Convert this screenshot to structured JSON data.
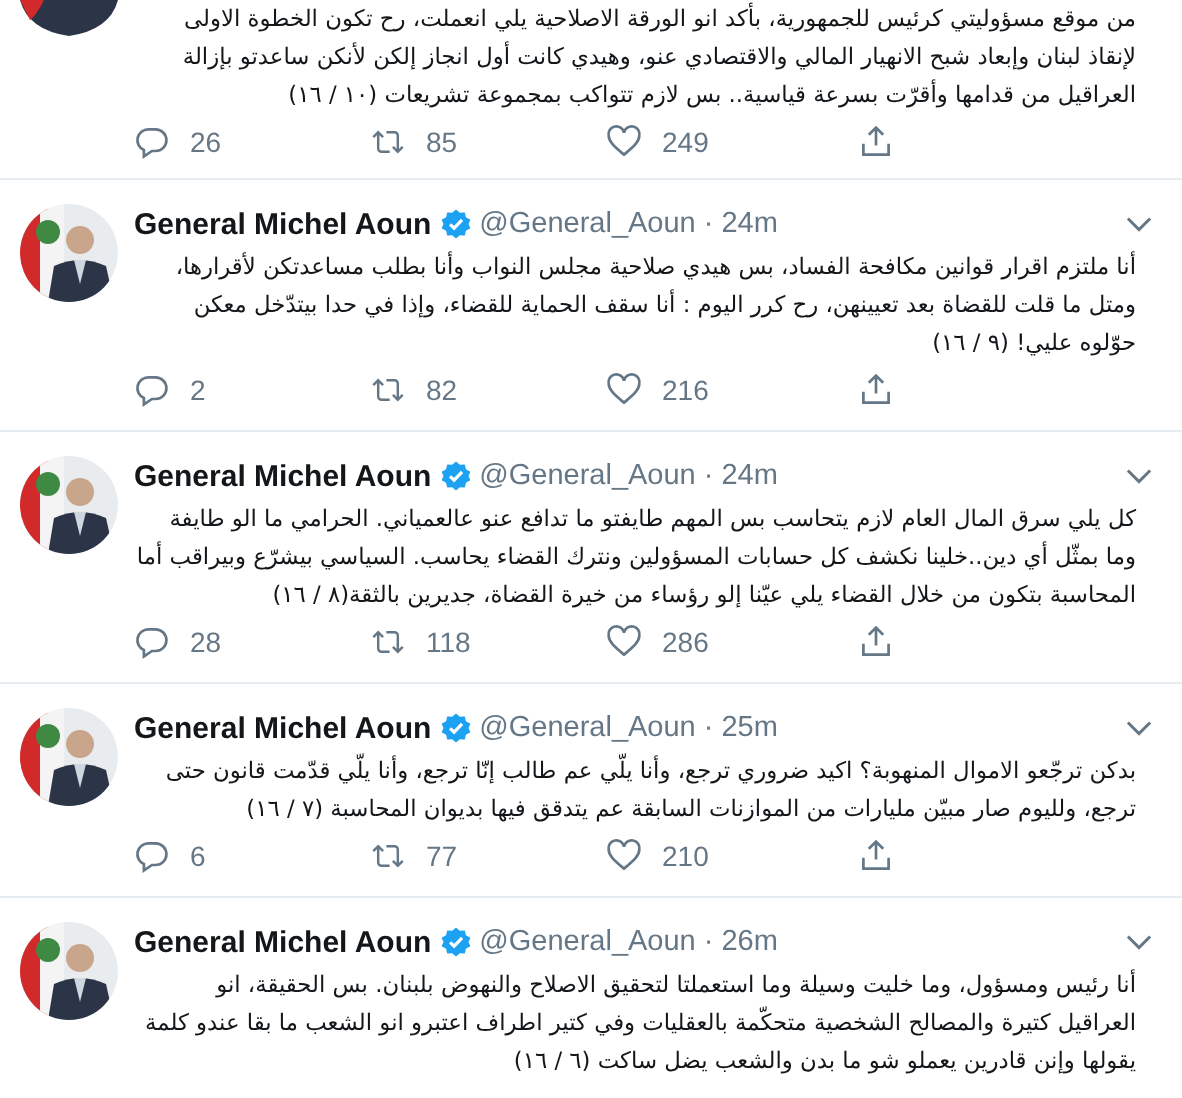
{
  "tweets": [
    {
      "header": false,
      "text": "من موقع مسؤوليتي كرئيس للجمهورية، بأكد انو الورقة الاصلاحية يلي انعملت، رح تكون الخطوة الاولى لإنقاذ لبنان وإبعاد شبح الانهيار المالي والاقتصادي عنو، وهيدي كانت أول انجاز إلكن لأنكن ساعدتو بإزالة العراقيل من قدامها وأقرّت بسرعة قياسية.. بس لازم تتواكب بمجموعة تشريعات (١٠ / ١٦)",
      "actions": {
        "replies": "26",
        "retweets": "85",
        "likes": "249"
      }
    },
    {
      "header": true,
      "name": "General Michel Aoun",
      "verified": true,
      "handle": "@General_Aoun",
      "separator": "·",
      "time": "24m",
      "text": "أنا ملتزم اقرار قوانين مكافحة الفساد، بس هيدي صلاحية مجلس النواب وأنا بطلب مساعدتكن لأقرارها، ومتل ما قلت للقضاة بعد تعيينهن، رح كرر اليوم : أنا سقف الحماية للقضاء، وإذا في حدا بيتدّخل معكن حوّلوه عليي! (٩ / ١٦)",
      "actions": {
        "replies": "2",
        "retweets": "82",
        "likes": "216"
      }
    },
    {
      "header": true,
      "name": "General Michel Aoun",
      "verified": true,
      "handle": "@General_Aoun",
      "separator": "·",
      "time": "24m",
      "text": "كل يلي سرق المال العام لازم يتحاسب بس المهم طايفتو ما تدافع عنو عالعمياني. الحرامي ما الو طايفة وما بمثّل أي دين..خلينا نكشف كل حسابات المسؤولين ونترك القضاء يحاسب. السياسي بيشرّع وبيراقب أما المحاسبة بتكون من خلال القضاء يلي عيّنا إلو رؤساء من خيرة القضاة، جديرين بالثقة(٨ / ١٦)",
      "actions": {
        "replies": "28",
        "retweets": "118",
        "likes": "286"
      }
    },
    {
      "header": true,
      "name": "General Michel Aoun",
      "verified": true,
      "handle": "@General_Aoun",
      "separator": "·",
      "time": "25m",
      "text": "بدكن ترجّعو الاموال المنهوبة؟ اكيد ضروري ترجع، وأنا يلّي عم طالب إنّا ترجع، وأنا يلّي قدّمت قانون حتى ترجع، ولليوم صار مبيّن مليارات من الموازنات السابقة عم يتدقق فيها بديوان المحاسبة (٧ / ١٦)",
      "actions": {
        "replies": "6",
        "retweets": "77",
        "likes": "210"
      }
    },
    {
      "header": true,
      "name": "General Michel Aoun",
      "verified": true,
      "handle": "@General_Aoun",
      "separator": "·",
      "time": "26m",
      "text": "أنا رئيس ومسؤول، وما خليت وسيلة وما استعملتا لتحقيق الاصلاح والنهوض بلبنان. بس الحقيقة، انو العراقيل كتيرة والمصالح الشخصية متحكّمة بالعقليات وفي كتير اطراف اعتبرو انو الشعب ما بقا عندو كلمة يقولها وإنن قادرين يعملو شو ما بدن والشعب يضل ساكت (٦ / ١٦)"
    }
  ]
}
